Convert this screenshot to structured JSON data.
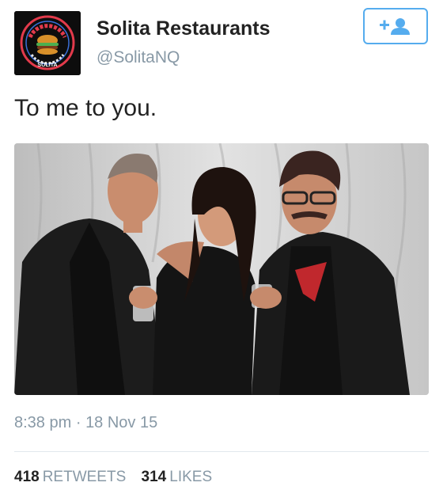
{
  "author": {
    "display_name": "Solita Restaurants",
    "handle": "@SolitaNQ",
    "avatar_icon": "restaurant-logo-icon",
    "avatar_text_top": "HOME OF THE BIG PIG",
    "avatar_text_bottom": "SOLITA"
  },
  "follow_button": {
    "icon": "add-user-icon",
    "color": "#55acee"
  },
  "tweet": {
    "text": "To me to you.",
    "time": "8:38 pm",
    "separator": "·",
    "date": "18 Nov 15"
  },
  "stats": {
    "retweets_count": "418",
    "retweets_label": "RETWEETS",
    "likes_count": "314",
    "likes_label": "LIKES"
  },
  "colors": {
    "accent": "#55acee",
    "secondary_text": "#8899a6"
  }
}
